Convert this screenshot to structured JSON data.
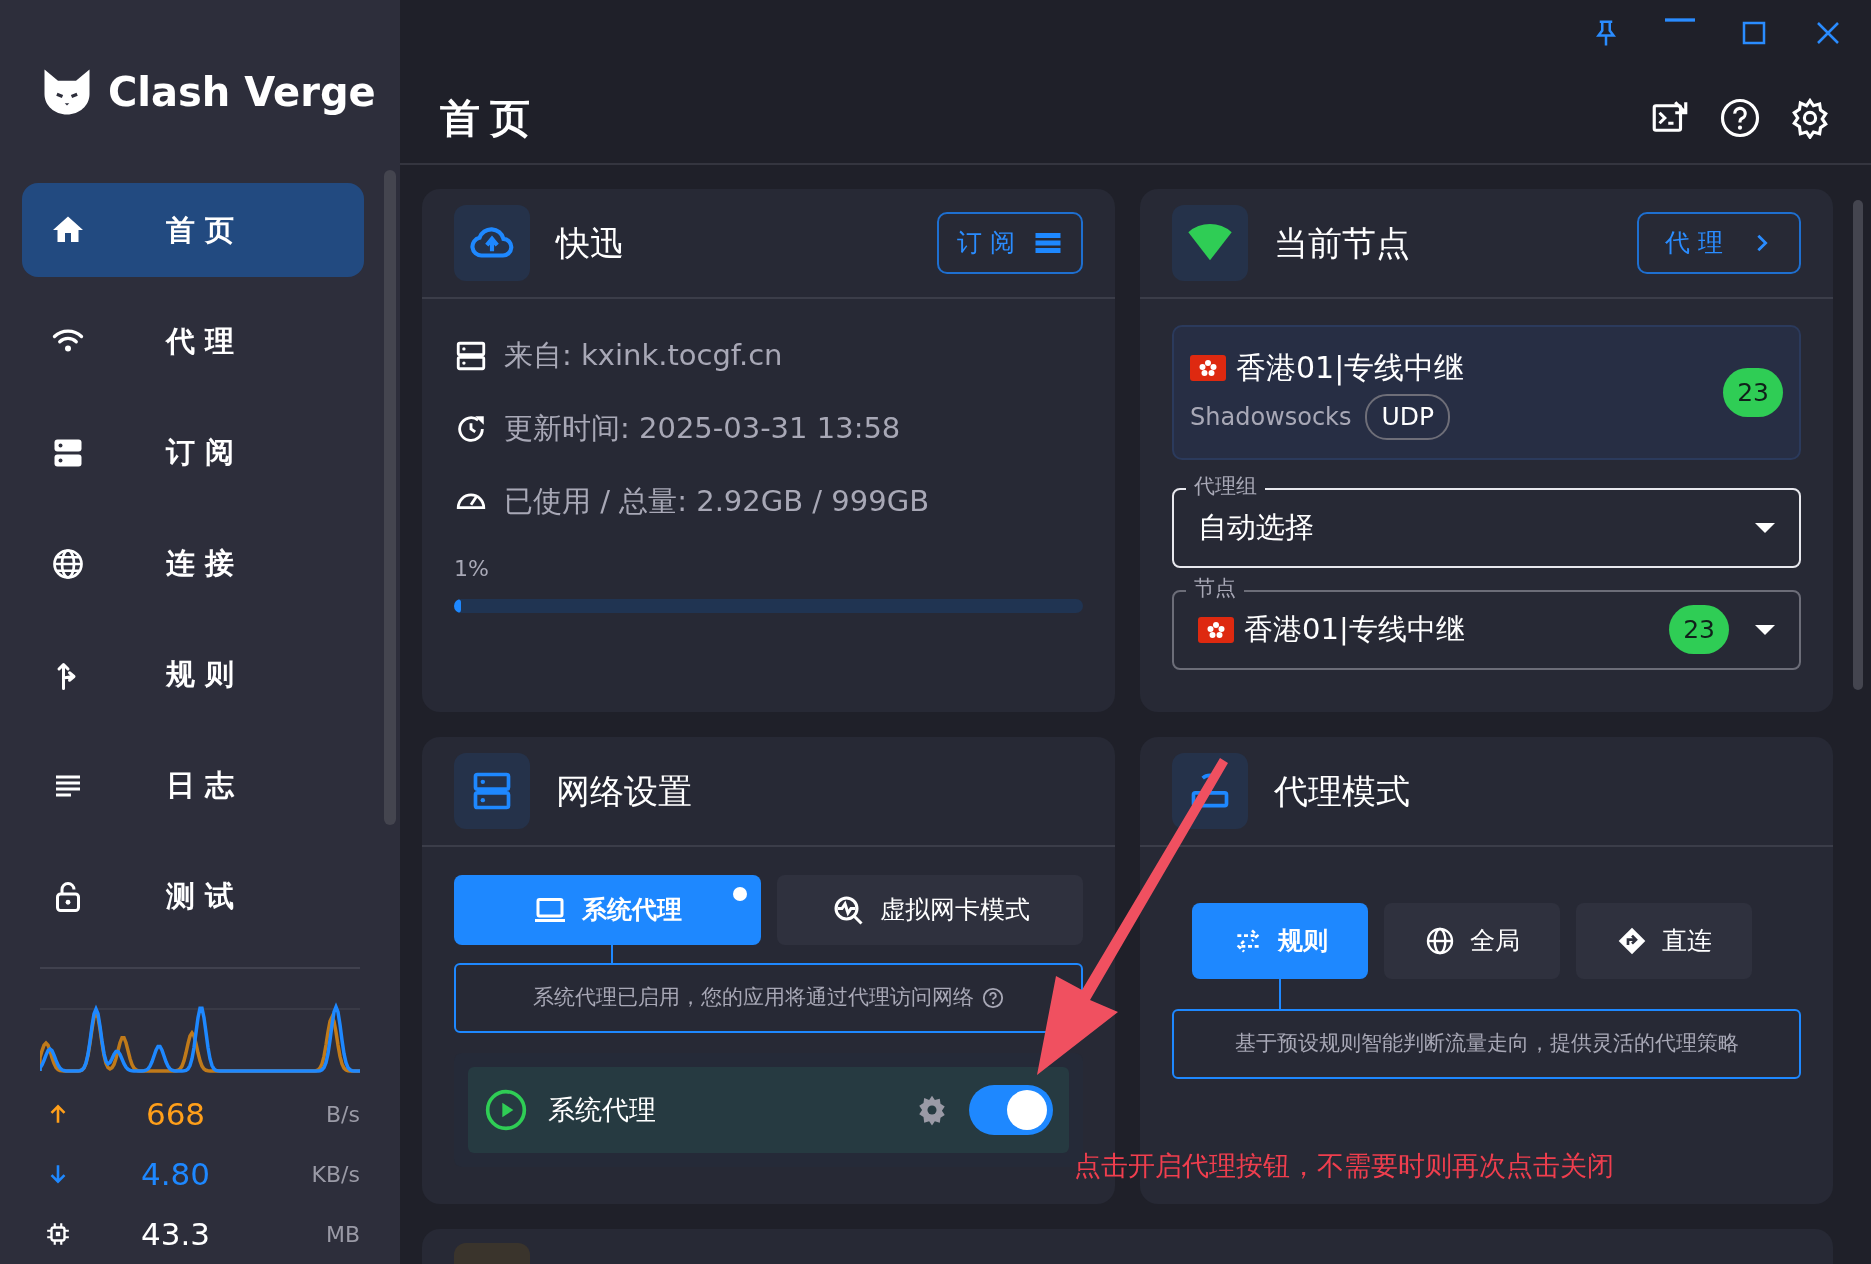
{
  "app": {
    "name": "Clash Verge"
  },
  "sidebar": {
    "items": [
      {
        "label": "首页",
        "selected": true
      },
      {
        "label": "代理",
        "selected": false
      },
      {
        "label": "订阅",
        "selected": false
      },
      {
        "label": "连接",
        "selected": false
      },
      {
        "label": "规则",
        "selected": false
      },
      {
        "label": "日志",
        "selected": false
      },
      {
        "label": "测试",
        "selected": false
      }
    ]
  },
  "traffic": {
    "upload": {
      "value": "668",
      "unit": "B/s"
    },
    "download": {
      "value": "4.80",
      "unit": "KB/s"
    },
    "memory": {
      "value": "43.3",
      "unit": "MB"
    }
  },
  "page_title": "首页",
  "profile_card": {
    "title": "快迅",
    "button": "订 阅",
    "rows": [
      "来自: kxink.tocgf.cn",
      "更新时间: 2025-03-31 13:58",
      "已使用 / 总量: 2.92GB / 999GB"
    ],
    "usage": "1%",
    "level": 0.01
  },
  "node_card": {
    "title": "当前节点",
    "button": "代 理",
    "node": {
      "name": "香港01|专线中继",
      "type": "Shadowsocks",
      "tag": "UDP",
      "delay": "23"
    },
    "group": {
      "label": "代理组",
      "value": "自动选择"
    },
    "node_select": {
      "label": "节点",
      "value": "香港01|专线中继",
      "delay": "23"
    }
  },
  "network_card": {
    "title": "网络设置",
    "tabs": [
      {
        "label": "系统代理",
        "selected": true
      },
      {
        "label": "虚拟网卡模式",
        "selected": false
      }
    ],
    "hint": "系统代理已启用，您的应用将通过代理访问网络",
    "switch_row": {
      "label": "系统代理",
      "on": true
    }
  },
  "mode_card": {
    "title": "代理模式",
    "modes": [
      {
        "label": "规则",
        "selected": true
      },
      {
        "label": "全局",
        "selected": false
      },
      {
        "label": "直连",
        "selected": false
      }
    ],
    "hint": "基于预设规则智能判断流量走向，提供灵活的代理策略"
  },
  "annotation": {
    "text": "点击开启代理按钮，不需要时则再次点击关闭"
  }
}
